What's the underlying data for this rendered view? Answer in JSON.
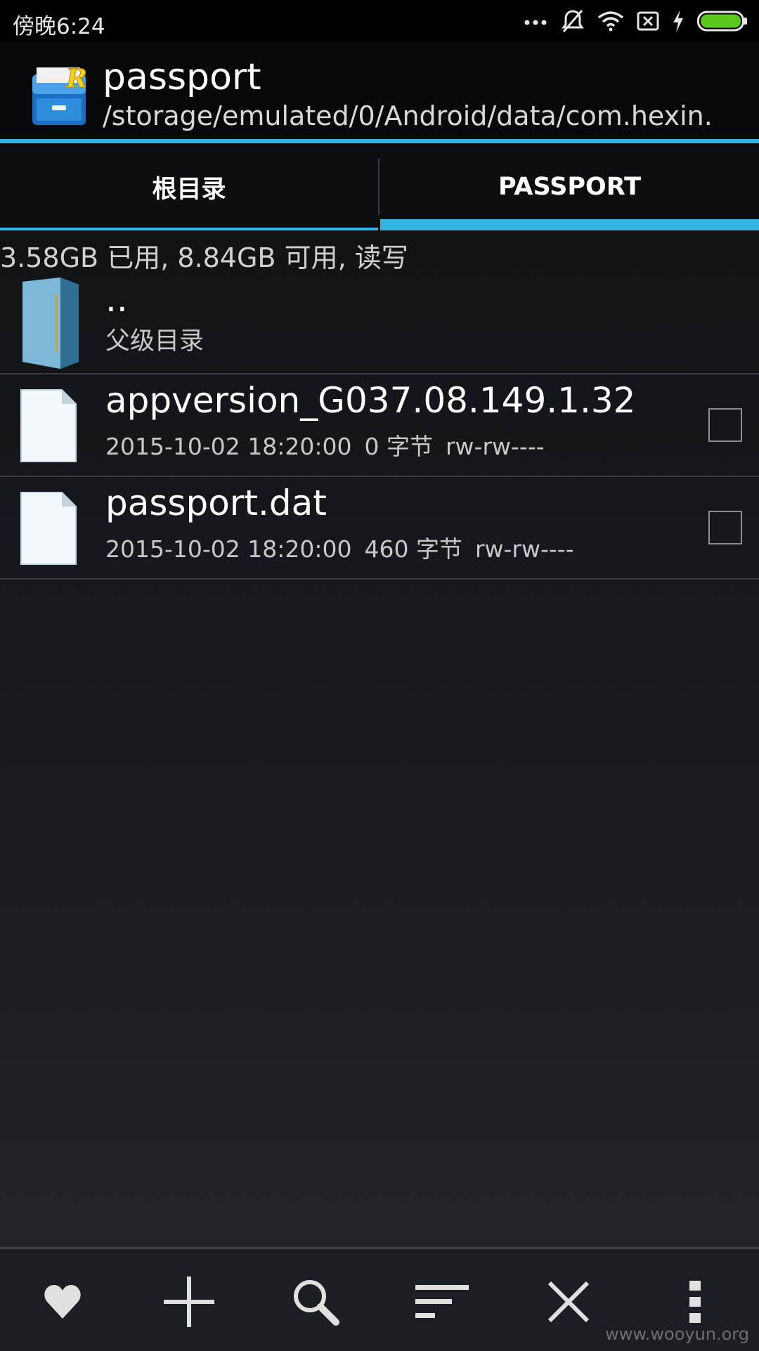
{
  "status_bar": {
    "time": "傍晚6:24",
    "icons": [
      "more-dots-icon",
      "mute-icon",
      "wifi-icon",
      "sim-off-icon",
      "charging-icon",
      "battery-icon"
    ],
    "battery_color": "#5ac81e"
  },
  "header": {
    "title": "passport",
    "path": "/storage/emulated/0/Android/data/com.hexin."
  },
  "tabs": [
    {
      "label": "根目录",
      "selected": false
    },
    {
      "label": "PASSPORT",
      "selected": true
    }
  ],
  "accent_color": "#33b5e5",
  "storage": {
    "info": "3.58GB 已用, 8.84GB 可用, 读写"
  },
  "parent_row": {
    "name": "..",
    "subtitle": "父级目录",
    "icon": "folder-icon"
  },
  "files": [
    {
      "name": "appversion_G037.08.149.1.32",
      "date": "2015-10-02 18:20:00",
      "size": "0 字节",
      "perm": "rw-rw----",
      "checked": false,
      "icon": "file-icon"
    },
    {
      "name": "passport.dat",
      "date": "2015-10-02 18:20:00",
      "size": "460 字节",
      "perm": "rw-rw----",
      "checked": false,
      "icon": "file-icon"
    }
  ],
  "bottom_actions": [
    "favorite-icon",
    "add-icon",
    "search-icon",
    "sort-icon",
    "close-icon",
    "overflow-menu-icon"
  ],
  "watermark": "www.wooyun.org"
}
